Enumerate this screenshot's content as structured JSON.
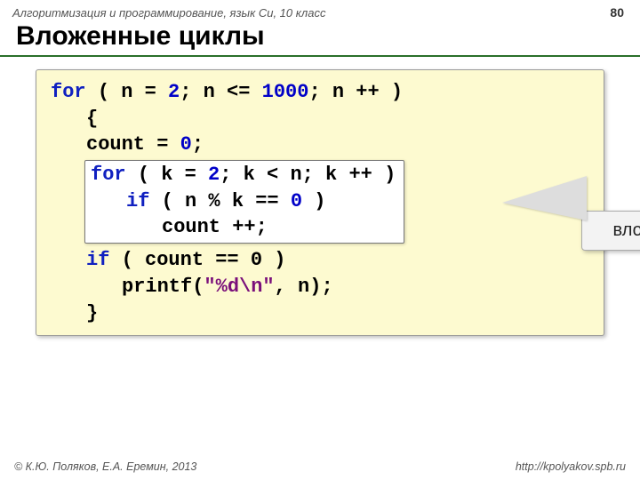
{
  "header": {
    "course": "Алгоритмизация и программирование, язык Си, 10 класс",
    "page": "80"
  },
  "title": "Вложенные циклы",
  "code": {
    "kw_for1": "for",
    "p_open1": "( n",
    "eq1": "=",
    "n2": "2",
    "semi1": "; n",
    "le": "<=",
    "n1000": "1000",
    "semi2": "; n",
    "pp1": "++",
    "close1": " )",
    "brace_open": "{",
    "count": "count",
    "eq2": "=",
    "zero1": "0",
    "semi3": ";",
    "kw_for2": "for",
    "p_open2": "( k",
    "eq3": "=",
    "k2": "2",
    "semi4": "; k",
    "lt": "<",
    "kn": "n; k",
    "pp2": "++",
    "close2": " )",
    "kw_if1": "if",
    "ifexpr1a": "( n",
    "mod": "%",
    "ifexpr1b": "k",
    "eqeq1": "==",
    "zero2": "0",
    "close3": " )",
    "count2": "count",
    "pp3": "++",
    "semi5": ";",
    "kw_if2": "if",
    "ifexpr2": "( count == 0 )",
    "printf": "printf(",
    "fmt": "\"%d\\n\"",
    "printf2": ", n);",
    "brace_close": "}"
  },
  "callout": "вложенный цикл",
  "footer": {
    "copyright": "© К.Ю. Поляков, Е.А. Еремин, 2013",
    "url": "http://kpolyakov.spb.ru"
  }
}
